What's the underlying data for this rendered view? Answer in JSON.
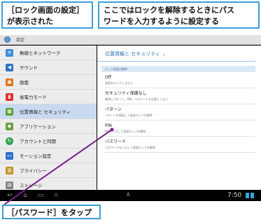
{
  "callouts": {
    "screen_shown": "［ロック画面の設定］\nが表示された",
    "explanation": "ここではロックを解除するときにパス\nワードを入力するように設定する",
    "instruction": "［パスワード］をタップ"
  },
  "action_bar": {
    "title": "設定"
  },
  "sidebar": {
    "items": [
      {
        "label": "無線とネットワーク",
        "icon": "wifi-icon",
        "color": "#3b8fd8"
      },
      {
        "label": "サウンド",
        "icon": "speaker-icon",
        "color": "#2f6fc8"
      },
      {
        "label": "画面",
        "icon": "display-icon",
        "color": "#e07020"
      },
      {
        "label": "省電力モード",
        "icon": "battery-icon",
        "color": "#e03030"
      },
      {
        "label": "位置情報と セキュリティ",
        "icon": "lock-grid-icon",
        "color": "#5aa030",
        "selected": true
      },
      {
        "label": "アプリケーション",
        "icon": "apps-icon",
        "color": "#6aa040"
      },
      {
        "label": "アカウントと同期",
        "icon": "sync-icon",
        "color": "#30a050"
      },
      {
        "label": "モーション設定",
        "icon": "motion-icon",
        "color": "#2f6fc8"
      },
      {
        "label": "プライバシー",
        "icon": "privacy-icon",
        "color": "#c09020"
      },
      {
        "label": "ストレージ",
        "icon": "storage-icon",
        "color": "#808080"
      }
    ]
  },
  "content": {
    "header": "位置情報と セキュリティ",
    "header_chevron": "›",
    "section_label": "ロック画面の解除",
    "options": [
      {
        "title": "Off",
        "desc": "画面をロックしません"
      },
      {
        "title": "セキュリティ保護なし",
        "desc": "解除にパターン、PIN、パスワードを必要としない"
      },
      {
        "title": "パターン",
        "desc": "パターンを描画して画面ロックを解除"
      },
      {
        "title": "PIN",
        "desc": "PINを入力して画面ロックを解除"
      },
      {
        "title": "パスワード",
        "desc": "パスワードを入力して画面ロックを解除"
      }
    ]
  },
  "system_bar": {
    "clock": "7:50"
  },
  "colors": {
    "callout_border": "#3aa0d8",
    "pointer": "#7a1f8a",
    "selected_bg": "#c9daf0"
  }
}
